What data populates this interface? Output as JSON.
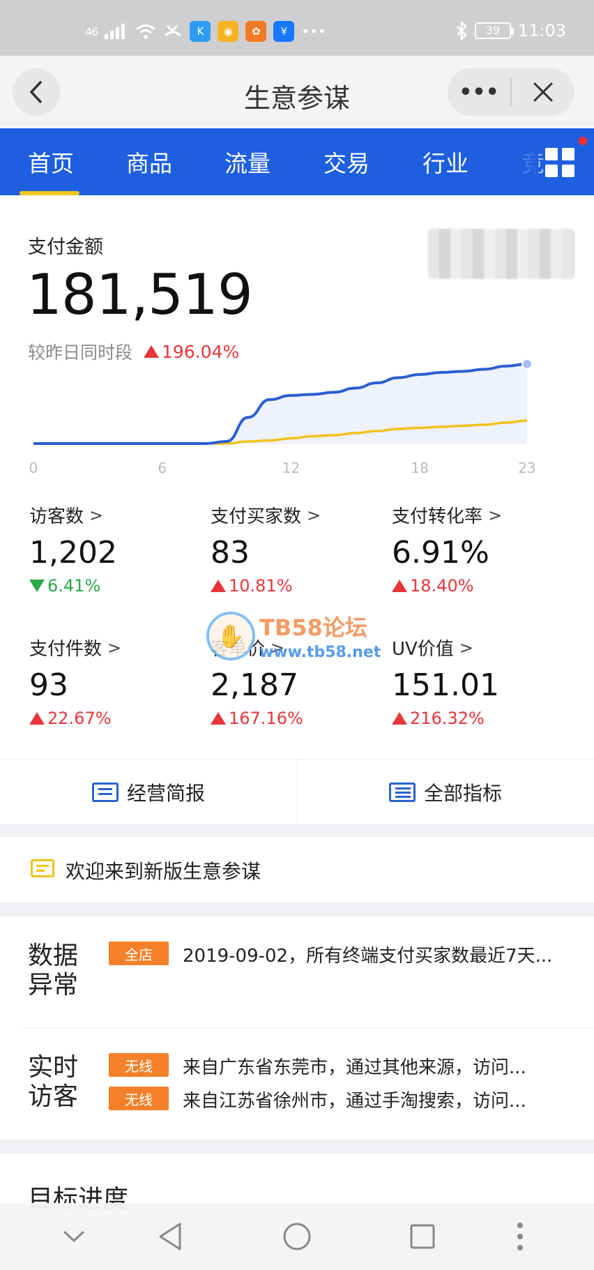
{
  "status_bar": {
    "signal": "46",
    "battery": "39",
    "time": "11:03",
    "app_icons": [
      {
        "icon": "app-blue-icon",
        "color": "#2d9cf0",
        "glyph": "K"
      },
      {
        "icon": "app-yellow-icon",
        "color": "#f6b324",
        "glyph": "◉"
      },
      {
        "icon": "app-orange-icon",
        "color": "#f37a27",
        "glyph": "✿"
      },
      {
        "icon": "app-alipay-icon",
        "color": "#1677ff",
        "glyph": "¥"
      }
    ]
  },
  "title_bar": {
    "title": "生意参谋",
    "more": "•••"
  },
  "tabs": [
    {
      "label": "首页",
      "active": true
    },
    {
      "label": "商品"
    },
    {
      "label": "流量"
    },
    {
      "label": "交易"
    },
    {
      "label": "行业"
    },
    {
      "label": "竞"
    }
  ],
  "summary": {
    "label": "支付金额",
    "value": "181,519",
    "compare_label": "较昨日同时段",
    "change": "196.04%",
    "change_dir": "up"
  },
  "chart_data": {
    "type": "line",
    "x": [
      0,
      6,
      12,
      18,
      23
    ],
    "x_ticks": [
      "0",
      "6",
      "12",
      "18",
      "23"
    ],
    "series": [
      {
        "color": "#2a5fd1",
        "values_by_hour": [
          0,
          0,
          0,
          0,
          0,
          0,
          0,
          0,
          0,
          0.02,
          0.25,
          0.42,
          0.46,
          0.47,
          0.49,
          0.53,
          0.58,
          0.63,
          0.66,
          0.68,
          0.69,
          0.71,
          0.74,
          0.76
        ]
      },
      {
        "color": "#f2c21b",
        "values_by_hour": [
          0,
          0,
          0,
          0,
          0,
          0,
          0,
          0,
          0,
          0,
          0.02,
          0.03,
          0.05,
          0.07,
          0.08,
          0.1,
          0.12,
          0.14,
          0.15,
          0.16,
          0.17,
          0.18,
          0.2,
          0.22
        ]
      }
    ],
    "colors": {
      "today": "#2a5fd1",
      "yesterday": "#f2c21b",
      "fill": "#eef2fd"
    }
  },
  "metrics": [
    {
      "label": "访客数",
      "value": "1,202",
      "change": "6.41%",
      "dir": "down"
    },
    {
      "label": "支付买家数",
      "value": "83",
      "change": "10.81%",
      "dir": "up"
    },
    {
      "label": "支付转化率",
      "value": "6.91%",
      "change": "18.40%",
      "dir": "up"
    },
    {
      "label": "支付件数",
      "value": "93",
      "change": "22.67%",
      "dir": "up"
    },
    {
      "label": "客单价",
      "value": "2,187",
      "change": "167.16%",
      "dir": "up"
    },
    {
      "label": "UV价值",
      "value": "151.01",
      "change": "216.32%",
      "dir": "up"
    }
  ],
  "watermark": {
    "line1": "TB58论坛",
    "line2": "www.tb58.net"
  },
  "actions": {
    "report": "经营简报",
    "all_metrics": "全部指标"
  },
  "welcome": "欢迎来到新版生意参谋",
  "anomaly": {
    "title": "数据异常",
    "tag": "全店",
    "text": "2019-09-02，所有终端支付买家数最近7天..."
  },
  "realtime": {
    "title": "实时访客",
    "rows": [
      {
        "tag": "无线",
        "text": "来自广东省东莞市，通过其他来源，访问..."
      },
      {
        "tag": "无线",
        "text": "来自江苏省徐州市，通过手淘搜索，访问..."
      }
    ]
  },
  "goal": {
    "title": "目标进度"
  },
  "colors": {
    "primary": "#1e5fe0",
    "up": "#e8353a",
    "down": "#2aa84a",
    "tag": "#f4812a",
    "tab_indicator": "#f5c518"
  }
}
